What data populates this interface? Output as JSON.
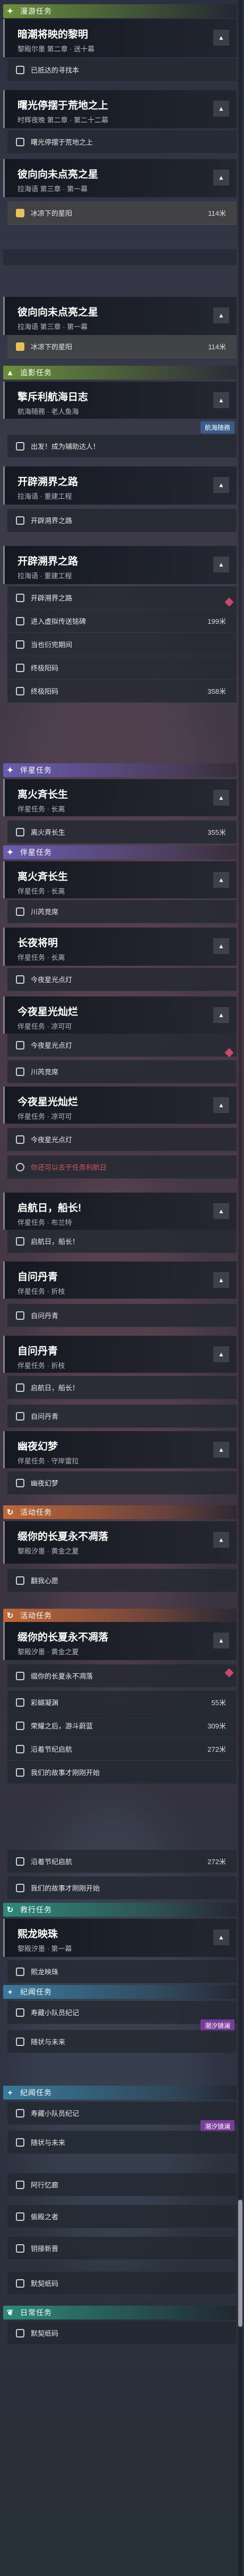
{
  "colors": {
    "main": "#6a8f3c",
    "sub": "#a07ac8",
    "companion": "#6a5cb0",
    "event": "#c0683a",
    "daily": "#2e8a7a",
    "story": "#3a7a9c"
  },
  "sections": [
    {
      "label": "漫游任务",
      "icon": "star"
    },
    {
      "label": "追影任务",
      "icon": "tri"
    },
    {
      "label": "伴星任务",
      "icon": "star"
    },
    {
      "label": "伴星任务",
      "icon": "star"
    },
    {
      "label": "活动任务",
      "icon": "cycle"
    },
    {
      "label": "活动任务",
      "icon": "cycle"
    },
    {
      "label": "救行任务",
      "icon": "cycle"
    },
    {
      "label": "纪闻任务",
      "icon": "plus"
    },
    {
      "label": "纪闻任务",
      "icon": "plus"
    },
    {
      "label": "日常任务",
      "icon": "leaf"
    }
  ],
  "cards": [
    {
      "title": "暗潮将映的黎明",
      "sub": "黎殿尔墨 第二章 · 送十幕"
    },
    {
      "title": "曙光停摆于荒地之上",
      "sub": "时辉夜晚 第二章 · 第二十二幕"
    },
    {
      "title": "彼向向未点亮之星",
      "sub": "拉海语 第三章 · 第一幕"
    },
    {
      "title": "彼向向未点亮之星",
      "sub": "拉海语 第三章 · 第一幕"
    },
    {
      "title": "擎斥利航海日志",
      "sub": "航海随務 · 老人鱼海"
    },
    {
      "title": "开辟溯界之路",
      "sub": "拉海语 · 重建工程"
    },
    {
      "title": "开辟溯界之路",
      "sub": "拉海语 · 重建工程"
    },
    {
      "title": "离火斉长生",
      "sub": "伴星任务 · 长离"
    },
    {
      "title": "离火斉长生",
      "sub": "伴星任务 · 长离"
    },
    {
      "title": "长夜将明",
      "sub": "伴星任务 · 长离"
    },
    {
      "title": "今夜星光灿烂",
      "sub": "伴星任务 · 凉可可"
    },
    {
      "title": "今夜星光灿烂",
      "sub": "伴星任务 · 凉可可"
    },
    {
      "title": "启航日，船长!",
      "sub": "伴星任务 · 布兰特"
    },
    {
      "title": "自问丹青",
      "sub": "伴星任务 · 折枝"
    },
    {
      "title": "自问丹青",
      "sub": "伴星任务 · 折枝"
    },
    {
      "title": "幽夜幻梦",
      "sub": "伴星任务 · 守岸雷拉"
    },
    {
      "title": "缀你的长夏永不凋落",
      "sub": "黎殿汐墨 · 黄金之夏"
    },
    {
      "title": "缀你的长夏永不凋落",
      "sub": "黎殿汐墨 · 黄金之夏"
    },
    {
      "title": "熙龙映珠",
      "sub": "黎殿汐墨 · 第一幕"
    }
  ],
  "objs": [
    "已抵达的寻找本",
    "曙光停摆于荒地之上",
    "冰凉下的星阳",
    "冰凉下的星阳",
    "出发！成为辅助达人！",
    "开辟溯界之路",
    "开辟溯界之路",
    "进入虚拟传送铭碑",
    "当也衍完期间",
    "终极阳码",
    "终极阳码",
    "离火斉长生",
    "川芮竞席",
    "今夜星光点灯",
    "川芮竞席",
    "今夜星光点灯",
    "你还可以去于任务利航日",
    "启航日，船长！",
    "启航日，船长！",
    "自问丹青",
    "自问丹青",
    "幽夜幻梦",
    "翻我心愿",
    "缀你的长夏永不凋落",
    "彩蝴凝渊",
    "荣耀之后，游斗蔚蓝",
    "沿着节纪启航",
    "我们的故事才刚刚开始",
    "沿着节纪启航",
    "我们的故事才刚刚开始",
    "熙龙映珠",
    "寿藏小队员纪记",
    "随状与未来",
    "寿藏小队员纪记",
    "随状与未来",
    "阿行忆廊",
    "偷殿之者",
    "钥接新晋",
    "默契纸码"
  ],
  "distances": [
    "114米",
    "114米",
    "199米",
    "358米",
    "355米",
    "55米",
    "309米",
    "272米",
    "272米"
  ],
  "badges": {
    "sail": "航海随務",
    "event_tag": "潮汐镜澜"
  }
}
